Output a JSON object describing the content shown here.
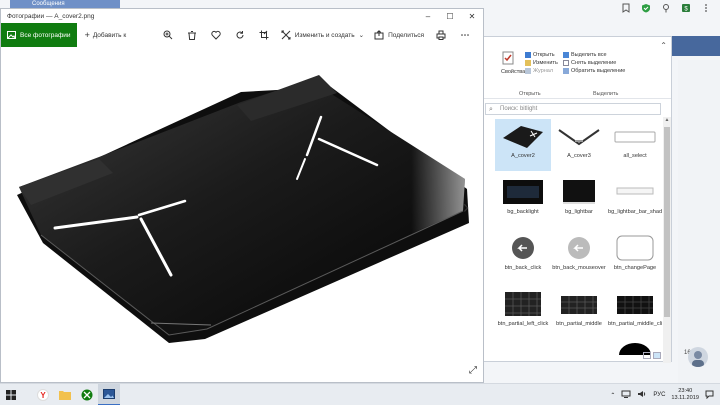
{
  "background_browser": {
    "tab_label": "Сообщения",
    "icons": [
      "bookmark-icon",
      "shield-check-icon",
      "pin-icon",
      "extension-icon",
      "menu-icon"
    ],
    "notification_count": "16"
  },
  "explorer": {
    "ribbon": {
      "open_label": "Открыть",
      "edit_label": "Изменить",
      "journal_label": "Журнал",
      "properties_label": "Свойства",
      "select_all_label": "Выделить все",
      "deselect_label": "Снять выделение",
      "invert_label": "Обратить выделение",
      "open_group_caption": "Открыть",
      "select_group_caption": "Выделить"
    },
    "search_placeholder": "Поиск: bitlight",
    "files": [
      {
        "name": "A_cover2",
        "thumb": "laptop-dark",
        "selected": true
      },
      {
        "name": "A_cover3",
        "thumb": "laptop-open",
        "selected": false
      },
      {
        "name": "all_select",
        "thumb": "white-bar",
        "selected": false
      },
      {
        "name": "bg_backlight",
        "thumb": "dark-keyboard",
        "selected": false
      },
      {
        "name": "bg_lightbar",
        "thumb": "lightbar",
        "selected": false
      },
      {
        "name": "bg_lightbar_bar_shadow",
        "thumb": "shadow-bar",
        "selected": false
      },
      {
        "name": "btn_back_click",
        "thumb": "back-dark",
        "selected": false
      },
      {
        "name": "btn_back_mouseover",
        "thumb": "back-light",
        "selected": false
      },
      {
        "name": "btn_changePage",
        "thumb": "rounded-rect",
        "selected": false
      },
      {
        "name": "btn_partial_left_click",
        "thumb": "keys-left",
        "selected": false
      },
      {
        "name": "btn_partial_middle",
        "thumb": "keys-middle",
        "selected": false
      },
      {
        "name": "btn_partial_middle_click",
        "thumb": "keys-middle-click",
        "selected": false
      }
    ]
  },
  "photos": {
    "title": "Фотографии — A_cover2.png",
    "all_photos_label": "Все фотографии",
    "add_label": "Добавить к",
    "edit_create_label": "Изменить и создать",
    "share_label": "Поделиться",
    "tool_icons": [
      "zoom-icon",
      "delete-icon",
      "favorite-icon",
      "rotate-icon",
      "crop-icon"
    ]
  },
  "taskbar": {
    "lang": "РУС",
    "time": "23:40",
    "date": "13.11.2019"
  },
  "colors": {
    "photos_accent": "#107c10",
    "selection": "#cce4f7",
    "taskbar": "#e8ecf1"
  }
}
